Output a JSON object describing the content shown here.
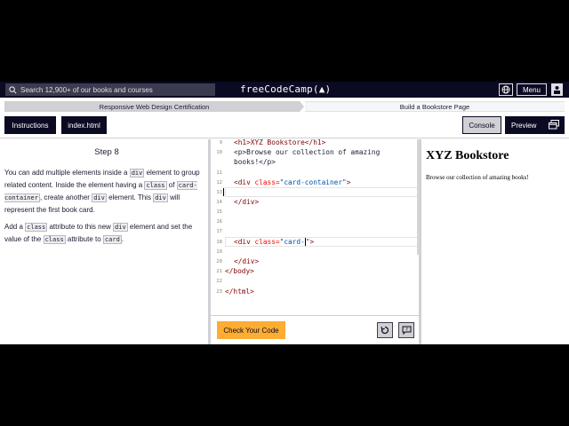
{
  "nav": {
    "search_placeholder": "Search 12,900+ of our books and courses",
    "brand": "freeCodeCamp(🔥)",
    "brand_text": "freeCodeCamp",
    "brand_suffix": "(▲)",
    "menu_label": "Menu"
  },
  "breadcrumb": {
    "certification": "Responsive Web Design Certification",
    "project": "Build a Bookstore Page"
  },
  "tabs": {
    "instructions": "Instructions",
    "file": "index.html",
    "console": "Console",
    "preview": "Preview"
  },
  "instructions": {
    "step": "Step 8",
    "p1": [
      "You can add multiple elements inside a ",
      "div",
      " element to group related content. Inside the element having a ",
      "class",
      " of ",
      "card-container",
      ", create another ",
      "div",
      " element. This ",
      "div",
      " will represent the first book card."
    ],
    "p2": [
      "Add a ",
      "class",
      " attribute to this new ",
      "div",
      " element and set the value of the ",
      "class",
      " attribute to ",
      "card",
      "."
    ]
  },
  "editor": {
    "lines": [
      {
        "n": "9",
        "indent": 2
      },
      {
        "n": "10",
        "indent": 2
      },
      {
        "n": "",
        "indent": 2
      },
      {
        "n": "11",
        "indent": 0
      },
      {
        "n": "12",
        "indent": 2
      },
      {
        "n": "13",
        "indent": 0
      },
      {
        "n": "14",
        "indent": 2
      },
      {
        "n": "15",
        "indent": 0
      },
      {
        "n": "16",
        "indent": 0
      },
      {
        "n": "17",
        "indent": 0
      },
      {
        "n": "18",
        "indent": 2
      },
      {
        "n": "19",
        "indent": 0
      },
      {
        "n": "20",
        "indent": 2
      },
      {
        "n": "21",
        "indent": 1
      },
      {
        "n": "22",
        "indent": 0
      },
      {
        "n": "23",
        "indent": 1
      }
    ],
    "code": {
      "l9": "<h1>XYZ Bookstore</h1>",
      "l10a": "<p>Browse our collection of amazing",
      "l10b": "books!</p>",
      "l12_tag": "<div",
      "l12_attr": " class=",
      "l12_val": "\"card-container\"",
      "l12_end": ">",
      "l14": "</div>",
      "l18_tag": "<div",
      "l18_attr": " class=",
      "l18_val": "\"card-",
      "l18_val2": "\"",
      "l18_end": ">",
      "l20": "</div>",
      "l21": "</body>",
      "l23": "</html>"
    },
    "check_label": "Check Your Code"
  },
  "preview": {
    "heading": "XYZ Bookstore",
    "paragraph": "Browse our collection of amazing books!"
  }
}
